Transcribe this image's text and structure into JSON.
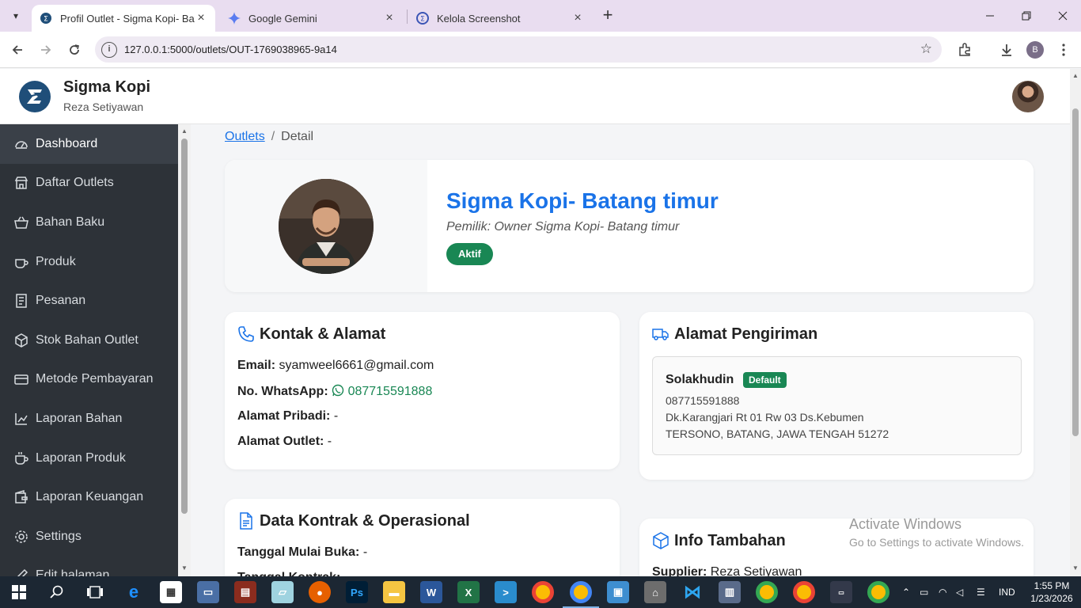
{
  "browser": {
    "tabs": [
      {
        "title": "Profil Outlet - Sigma Kopi- Bata",
        "active": true
      },
      {
        "title": "Google Gemini",
        "active": false
      },
      {
        "title": "Kelola Screenshot",
        "active": false
      }
    ],
    "url": "127.0.0.1:5000/outlets/OUT-1769038965-9a14",
    "profile_initial": "B"
  },
  "app": {
    "brand": "Sigma Kopi",
    "user": "Reza Setiyawan"
  },
  "sidebar": {
    "items": [
      {
        "label": "Dashboard",
        "icon": "gauge-icon",
        "active": true
      },
      {
        "label": "Daftar Outlets",
        "icon": "store-icon"
      },
      {
        "label": "Bahan Baku",
        "icon": "basket-icon"
      },
      {
        "label": "Produk",
        "icon": "coffee-icon"
      },
      {
        "label": "Pesanan",
        "icon": "receipt-icon"
      },
      {
        "label": "Stok Bahan Outlet",
        "icon": "box-icon"
      },
      {
        "label": "Metode Pembayaran",
        "icon": "card-icon"
      },
      {
        "label": "Laporan Bahan",
        "icon": "chart-icon"
      },
      {
        "label": "Laporan Produk",
        "icon": "cup-icon"
      },
      {
        "label": "Laporan Keuangan",
        "icon": "wallet-icon"
      },
      {
        "label": "Settings",
        "icon": "gear-icon"
      },
      {
        "label": "Edit halaman",
        "icon": "edit-icon"
      }
    ]
  },
  "breadcrumb": {
    "link": "Outlets",
    "sep": "/",
    "current": "Detail"
  },
  "outlet": {
    "name": "Sigma Kopi- Batang timur",
    "owner": "Pemilik: Owner Sigma Kopi- Batang timur",
    "status": "Aktif"
  },
  "kontak": {
    "title": "Kontak & Alamat",
    "email_label": "Email:",
    "email": "syamweel6661@gmail.com",
    "wa_label": "No. WhatsApp:",
    "wa": "087715591888",
    "pribadi_label": "Alamat Pribadi:",
    "pribadi": "-",
    "outlet_label": "Alamat Outlet:",
    "outlet": "-"
  },
  "pengiriman": {
    "title": "Alamat Pengiriman",
    "name": "Solakhudin",
    "badge": "Default",
    "phone": "087715591888",
    "line1": "Dk.Karangjari Rt 01 Rw 03 Ds.Kebumen",
    "line2": "TERSONO, BATANG, JAWA TENGAH 51272"
  },
  "kontrak": {
    "title": "Data Kontrak & Operasional",
    "mulai_label": "Tanggal Mulai Buka:",
    "mulai": "-",
    "kontrak_label": "Tanggal Kontrak:"
  },
  "info": {
    "title": "Info Tambahan",
    "supplier_label": "Supplier:",
    "supplier": "Reza Setiyawan"
  },
  "watermark": {
    "line1": "Activate Windows",
    "line2": "Go to Settings to activate Windows."
  },
  "taskbar": {
    "lang": "IND",
    "time": "1:55 PM",
    "date": "1/23/2026"
  }
}
